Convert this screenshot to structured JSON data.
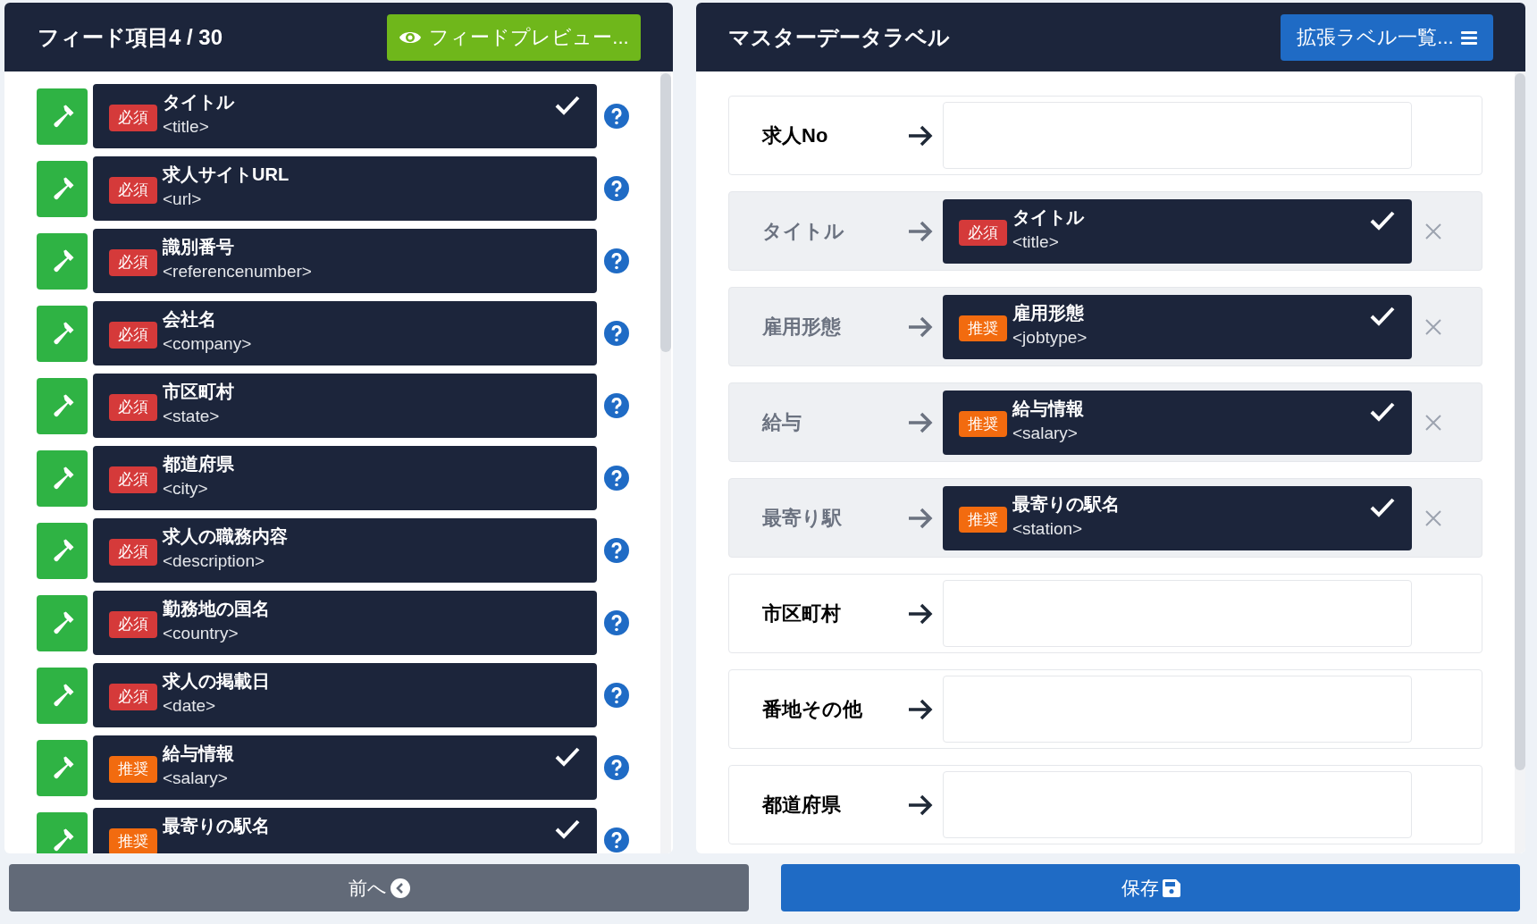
{
  "feed_panel": {
    "title": "フィード項目4 / 30",
    "preview_button": "フィードプレビュー...",
    "items": [
      {
        "kind": "required",
        "badge": "必須",
        "label": "タイトル",
        "tag": "<title>",
        "checked": true
      },
      {
        "kind": "required",
        "badge": "必須",
        "label": "求人サイトURL",
        "tag": "<url>",
        "checked": false
      },
      {
        "kind": "required",
        "badge": "必須",
        "label": "識別番号",
        "tag": "<referencenumber>",
        "checked": false
      },
      {
        "kind": "required",
        "badge": "必須",
        "label": "会社名",
        "tag": "<company>",
        "checked": false
      },
      {
        "kind": "required",
        "badge": "必須",
        "label": "市区町村",
        "tag": "<state>",
        "checked": false
      },
      {
        "kind": "required",
        "badge": "必須",
        "label": "都道府県",
        "tag": "<city>",
        "checked": false
      },
      {
        "kind": "required",
        "badge": "必須",
        "label": "求人の職務内容",
        "tag": "<description>",
        "checked": false
      },
      {
        "kind": "required",
        "badge": "必須",
        "label": "勤務地の国名",
        "tag": "<country>",
        "checked": false
      },
      {
        "kind": "required",
        "badge": "必須",
        "label": "求人の掲載日",
        "tag": "<date>",
        "checked": false
      },
      {
        "kind": "recommended",
        "badge": "推奨",
        "label": "給与情報",
        "tag": "<salary>",
        "checked": true
      },
      {
        "kind": "recommended",
        "badge": "推奨",
        "label": "最寄りの駅名",
        "checked": true
      }
    ]
  },
  "master_panel": {
    "title": "マスターデータラベル",
    "extended_button": "拡張ラベル一覧...",
    "rows": [
      {
        "label": "求人No"
      },
      {
        "label": "タイトル",
        "mapped": {
          "kind": "required",
          "badge": "必須",
          "label": "タイトル",
          "tag": "<title>",
          "checked": true
        }
      },
      {
        "label": "雇用形態",
        "mapped": {
          "kind": "recommended",
          "badge": "推奨",
          "label": "雇用形態",
          "tag": "<jobtype>",
          "checked": true
        }
      },
      {
        "label": "給与",
        "mapped": {
          "kind": "recommended",
          "badge": "推奨",
          "label": "給与情報",
          "tag": "<salary>",
          "checked": true
        }
      },
      {
        "label": "最寄り駅",
        "mapped": {
          "kind": "recommended",
          "badge": "推奨",
          "label": "最寄りの駅名",
          "tag": "<station>",
          "checked": true
        }
      },
      {
        "label": "市区町村"
      },
      {
        "label": "番地その他"
      },
      {
        "label": "都道府県"
      }
    ]
  },
  "footer": {
    "back_button": "前へ",
    "save_button": "保存"
  }
}
